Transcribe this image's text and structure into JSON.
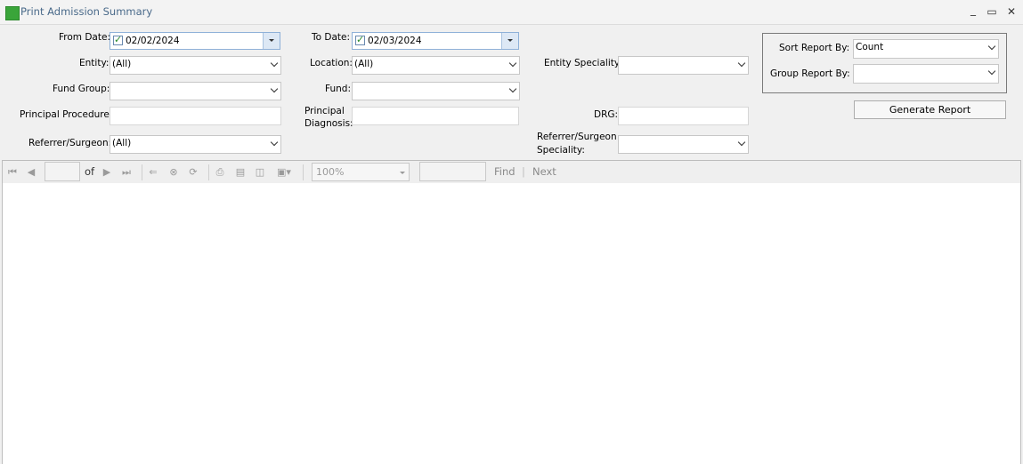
{
  "window": {
    "title": "Print Admission Summary",
    "minimize": "_",
    "maximize": "▭",
    "close": "✕"
  },
  "form": {
    "from_date": {
      "label": "From Date:",
      "value": "02/02/2024",
      "checked": true
    },
    "to_date": {
      "label": "To Date:",
      "value": "02/03/2024",
      "checked": true
    },
    "entity": {
      "label": "Entity:",
      "value": "(All)"
    },
    "location": {
      "label": "Location:",
      "value": "(All)"
    },
    "entity_speciality": {
      "label": "Entity Speciality:",
      "value": ""
    },
    "fund_group": {
      "label": "Fund Group:",
      "value": ""
    },
    "fund": {
      "label": "Fund:",
      "value": ""
    },
    "principal_procedure": {
      "label": "Principal Procedure:",
      "value": ""
    },
    "principal_diagnosis": {
      "label_line1": "Principal",
      "label_line2": "Diagnosis:",
      "value": ""
    },
    "drg": {
      "label": "DRG:",
      "value": ""
    },
    "referrer_surgeon": {
      "label": "Referrer/Surgeon:",
      "value": "(All)"
    },
    "referrer_surgeon_speciality": {
      "label_line1": "Referrer/Surgeon",
      "label_line2": "Speciality:",
      "value": ""
    },
    "sort_report_by": {
      "label": "Sort Report By:",
      "value": "Count"
    },
    "group_report_by": {
      "label": "Group Report By:",
      "value": ""
    },
    "generate_button": "Generate Report"
  },
  "viewer_toolbar": {
    "page_of": "of",
    "zoom": "100%",
    "find": "Find",
    "find_sep": "|",
    "next": "Next",
    "icons": [
      "first-page-icon",
      "previous-page-icon",
      "next-page-icon",
      "last-page-icon",
      "back-icon",
      "stop-icon",
      "refresh-icon",
      "print-icon",
      "print-layout-icon",
      "page-setup-icon",
      "export-icon"
    ]
  }
}
